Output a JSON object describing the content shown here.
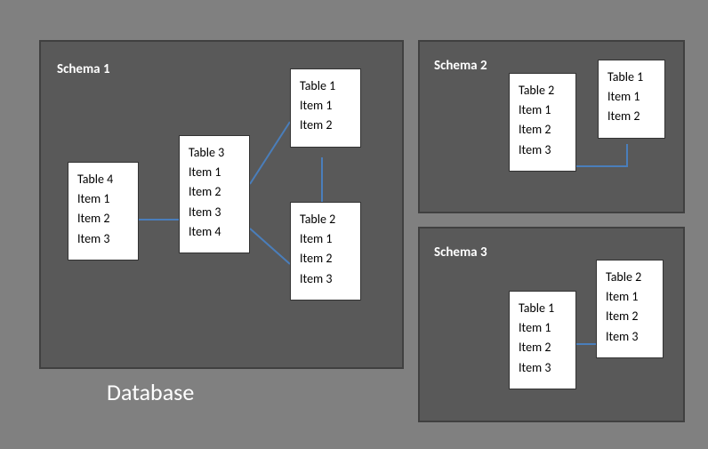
{
  "databaseLabel": "Database",
  "schemas": [
    {
      "label": "Schema 1",
      "tables": [
        {
          "name": "Table 4",
          "items": [
            "Item 1",
            "Item 2",
            "Item 3"
          ]
        },
        {
          "name": "Table 3",
          "items": [
            "Item 1",
            "Item 2",
            "Item 3",
            "Item 4"
          ]
        },
        {
          "name": "Table 1",
          "items": [
            "Item 1",
            "Item 2"
          ]
        },
        {
          "name": "Table 2",
          "items": [
            "Item 1",
            "Item 2",
            "Item 3"
          ]
        }
      ]
    },
    {
      "label": "Schema 2",
      "tables": [
        {
          "name": "Table 2",
          "items": [
            "Item 1",
            "Item 2",
            "Item 3"
          ]
        },
        {
          "name": "Table 1",
          "items": [
            "Item 1",
            "Item 2"
          ]
        }
      ]
    },
    {
      "label": "Schema 3",
      "tables": [
        {
          "name": "Table 1",
          "items": [
            "Item 1",
            "Item 2",
            "Item 3"
          ]
        },
        {
          "name": "Table 2",
          "items": [
            "Item 1",
            "Item 2",
            "Item 3"
          ]
        }
      ]
    }
  ]
}
